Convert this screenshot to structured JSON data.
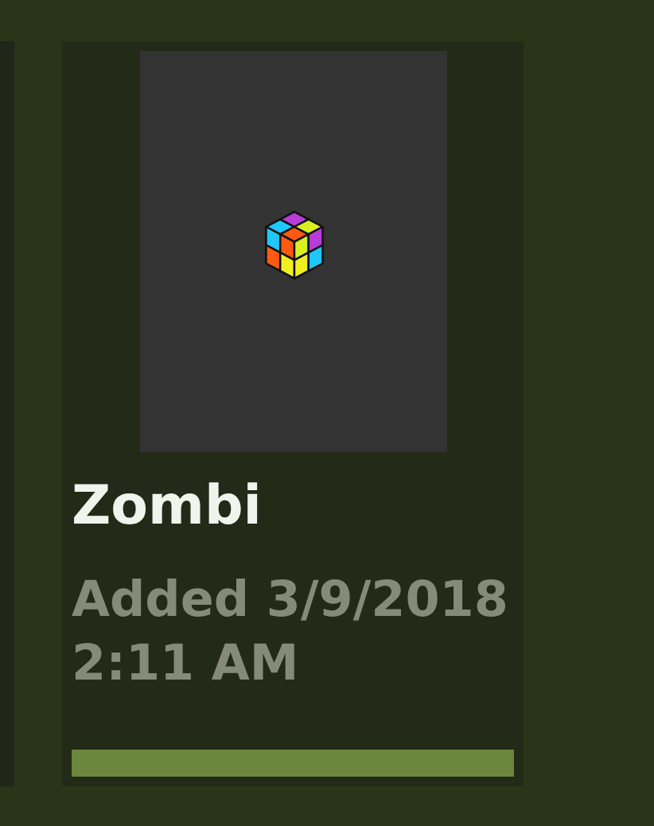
{
  "cards": [
    {
      "title": "Zombi",
      "added": "Added 3/9/2018 2:11 AM"
    }
  ]
}
